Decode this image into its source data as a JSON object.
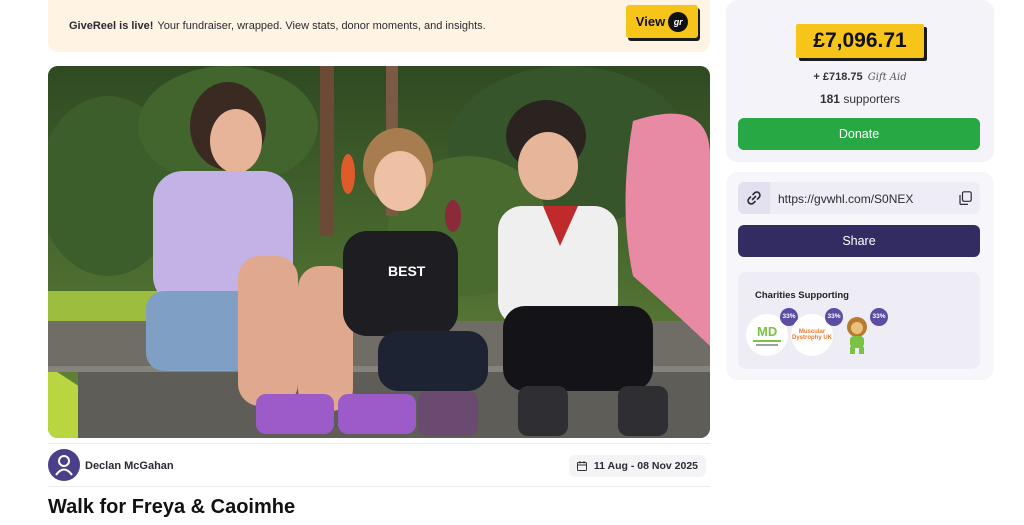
{
  "banner": {
    "title": "GiveReel is live!",
    "text": "Your fundraiser, wrapped. View stats, donor moments, and insights.",
    "view_label": "View",
    "view_badge": "gr"
  },
  "hero": {
    "image": "three-children-sitting-on-steps-photo"
  },
  "owner": {
    "name": "Declan McGahan",
    "avatar": "user-icon"
  },
  "dates": {
    "range": "11 Aug - 08 Nov 2025"
  },
  "page": {
    "title": "Walk for Freya & Caoimhe"
  },
  "stats": {
    "amount": "£7,096.71",
    "giftaid_prefix": "+ £718.75",
    "giftaid_label": "Gift Aid",
    "supporters_count": "181",
    "supporters_label": "supporters",
    "donate_label": "Donate"
  },
  "share": {
    "url": "https://gvwhl.com/S0NEX",
    "share_label": "Share"
  },
  "charities": {
    "title": "Charities Supporting",
    "items": [
      {
        "name": "Myotonic Dystrophy Support Group",
        "logo_text": "MD",
        "percent": "33%"
      },
      {
        "name": "Muscular Dystrophy UK",
        "logo_text": "Muscular Dystrophy UK",
        "percent": "33%"
      },
      {
        "name": "Lion mascot charity",
        "logo_text": "",
        "percent": "33%"
      }
    ]
  },
  "colors": {
    "accent_yellow": "#f7c51a",
    "donate_green": "#28a745",
    "share_purple": "#322c63",
    "banner_bg": "#fff4e3"
  }
}
